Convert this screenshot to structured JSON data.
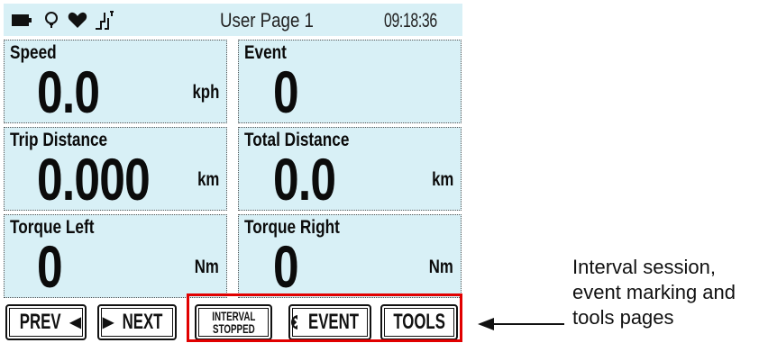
{
  "status_bar": {
    "icons": [
      "battery-icon",
      "bulb-icon",
      "heart-icon",
      "sensor-icon"
    ],
    "page_title": "User Page 1",
    "clock": "09:18:36"
  },
  "tiles": [
    {
      "label": "Speed",
      "value": "0.0",
      "unit": "kph"
    },
    {
      "label": "Event",
      "value": "0",
      "unit": ""
    },
    {
      "label": "Trip Distance",
      "value": "0.000",
      "unit": "km"
    },
    {
      "label": "Total Distance",
      "value": "0.0",
      "unit": "km"
    },
    {
      "label": "Torque Left",
      "value": "0",
      "unit": "Nm"
    },
    {
      "label": "Torque Right",
      "value": "0",
      "unit": "Nm"
    }
  ],
  "softkeys": {
    "prev": "PREV",
    "next": "NEXT",
    "interval_line1": "INTERVAL",
    "interval_line2": "STOPPED",
    "event": "EVENT",
    "tools": "TOOLS"
  },
  "annotation": {
    "text_line1": "Interval session,",
    "text_line2": "event marking and",
    "text_line3": "tools pages"
  },
  "colors": {
    "tile_background": "#d8f0f6",
    "highlight": "#e10000"
  }
}
